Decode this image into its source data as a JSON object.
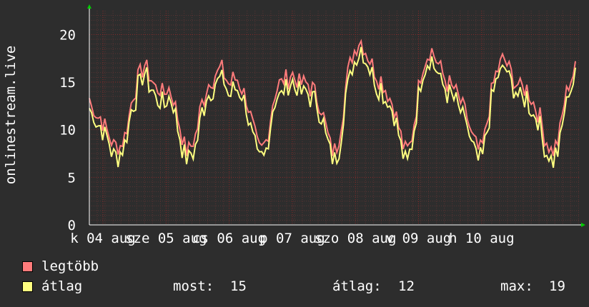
{
  "chart_data": {
    "type": "line",
    "ylabel": "onlinestream.live",
    "ylim": [
      0,
      22.5
    ],
    "yticks": [
      0,
      5,
      10,
      15,
      20
    ],
    "xticks": [
      "k 04 aug",
      "sze 05 aug",
      "cs 06 aug",
      "p 07 aug",
      "szo 08 aug",
      "v 09 aug",
      "h 10 aug"
    ],
    "grid": true,
    "series": [
      {
        "name": "legtöbb",
        "color": "#ff7b7b",
        "days": [
          [
            13,
            12,
            12,
            11.5,
            11,
            11,
            10.5,
            10,
            9.5,
            9,
            8.5,
            8,
            8,
            8,
            8,
            8.5,
            9,
            10,
            11,
            12.5,
            13.5,
            14,
            15,
            15.5,
            16,
            16.5,
            16,
            15.5,
            15,
            14.5,
            14,
            14,
            14
          ],
          [
            13.5,
            13.5,
            14,
            14,
            13.5,
            13,
            12,
            11,
            10,
            9,
            8,
            7.5,
            7.5,
            8,
            8.5,
            9,
            10,
            11.5,
            12.5,
            13,
            14,
            14.5,
            15,
            15,
            15.5,
            15.5,
            16,
            16,
            15.5,
            15,
            14.5,
            14.5,
            15
          ],
          [
            15,
            15,
            14.5,
            14,
            13.5,
            13,
            12,
            11,
            10,
            9,
            8,
            7.5,
            7.5,
            8,
            8.5,
            9.5,
            11,
            12.5,
            13.5,
            14,
            14.5,
            14.5,
            15,
            15,
            15,
            15.5,
            15.5,
            15,
            15,
            14.5,
            14.5,
            14.5,
            14.5
          ],
          [
            14.5,
            14,
            14,
            13.5,
            13,
            12.5,
            12,
            11,
            10,
            9,
            8,
            7.5,
            7.5,
            8,
            9,
            10.5,
            12,
            14,
            15.5,
            16.5,
            17.5,
            18,
            18.5,
            19,
            19,
            18.5,
            18,
            17.5,
            17,
            16.5,
            16,
            15.5,
            15
          ],
          [
            15,
            14.5,
            14,
            13.5,
            13,
            12.5,
            12,
            11,
            10,
            9,
            8,
            7.5,
            7.5,
            8,
            9,
            10.5,
            12,
            14,
            15.5,
            16.5,
            17,
            17.5,
            18,
            18,
            17.5,
            17,
            16.5,
            16,
            15.5,
            15,
            14.5,
            14.5,
            14
          ],
          [
            14,
            13.5,
            13,
            12.5,
            12,
            11.5,
            11,
            10,
            9,
            8.5,
            8,
            7.5,
            7.5,
            8,
            9,
            10.5,
            12,
            13.5,
            14.5,
            15.5,
            16,
            16.5,
            17,
            17,
            16.5,
            16,
            15.5,
            15,
            14.5,
            14.5,
            14,
            14,
            14
          ],
          [
            14,
            13.5,
            13,
            12.5,
            12,
            11.5,
            11,
            10,
            9,
            8.5,
            8,
            7.5,
            7.5,
            8,
            8.5,
            9.5,
            11,
            12.5,
            13.5,
            14.5,
            15,
            15.5,
            16
          ]
        ]
      },
      {
        "name": "átlag",
        "color": "#ffff80"
      }
    ],
    "stats": {
      "most": 15,
      "atlag": 12,
      "max": 19
    }
  },
  "legend": [
    {
      "name": "legtöbb",
      "color": "#ff7b7b"
    },
    {
      "name": "átlag",
      "color": "#ffff80"
    }
  ],
  "stats": {
    "most_label": "most:",
    "most_value": "15",
    "atlag_label": "átlag:",
    "atlag_value": "12",
    "max_label": "max:",
    "max_value": "19"
  }
}
